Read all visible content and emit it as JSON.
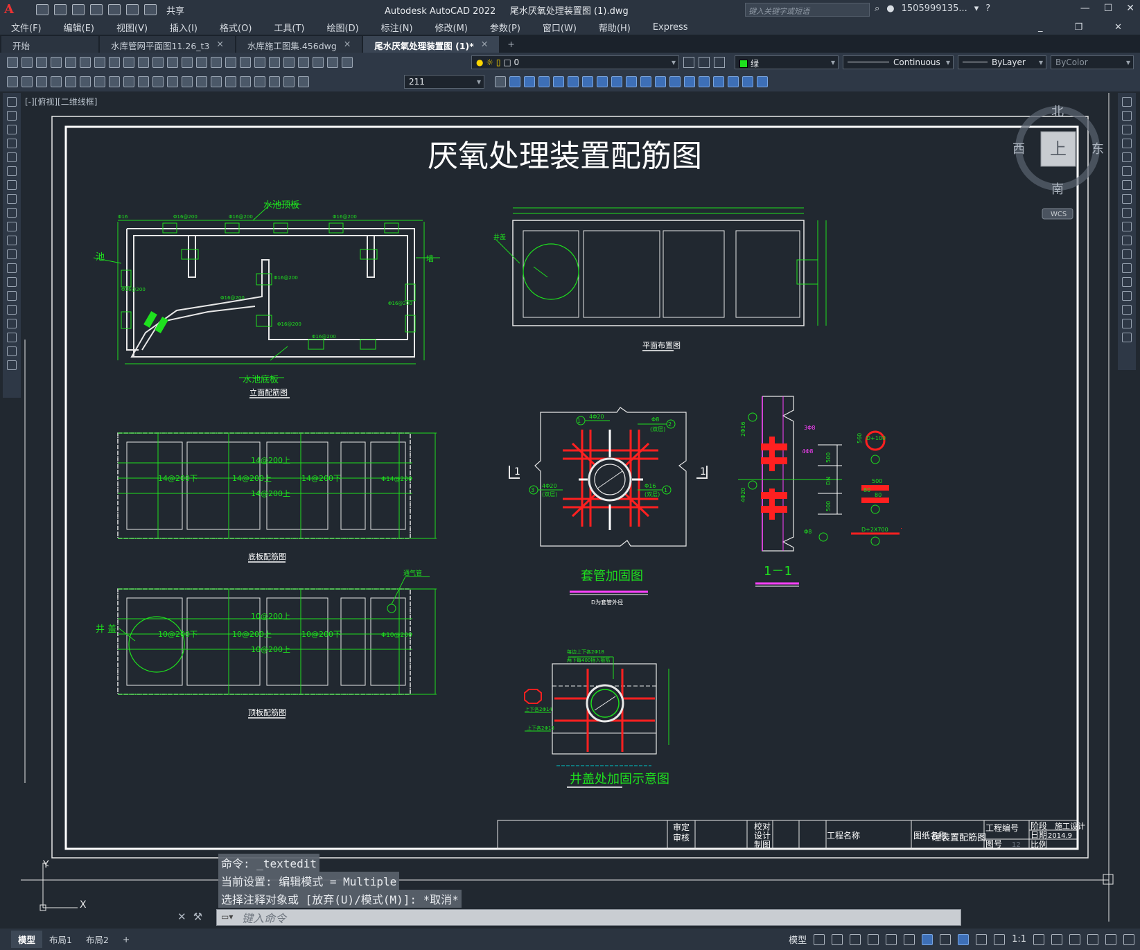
{
  "titlebar": {
    "share_label": "共享",
    "app_name": "Autodesk AutoCAD 2022",
    "file_name": "尾水厌氧处理装置图 (1).dwg",
    "search_placeholder": "键入关键字或短语",
    "user": "1505999135...",
    "help": "?"
  },
  "menu": [
    "文件(F)",
    "编辑(E)",
    "视图(V)",
    "插入(I)",
    "格式(O)",
    "工具(T)",
    "绘图(D)",
    "标注(N)",
    "修改(M)",
    "参数(P)",
    "窗口(W)",
    "帮助(H)",
    "Express"
  ],
  "tabs": [
    {
      "label": "开始",
      "closable": false,
      "active": false
    },
    {
      "label": "水库管网平面图11.26_t3",
      "closable": true,
      "active": false
    },
    {
      "label": "水库施工图集.456dwg",
      "closable": true,
      "active": false
    },
    {
      "label": "尾水厌氧处理装置图 (1)*",
      "closable": true,
      "active": true
    }
  ],
  "tab_close": "✕",
  "tab_add": "+",
  "layer_dropdown": "0",
  "color_dropdown": "绿",
  "linetype_dropdown": "Continuous",
  "lineweight_dropdown": "ByLayer",
  "plotstyle_dropdown": "ByColor",
  "dimstyle_dropdown": "211",
  "view_label": "[-][俯视][二维线框]",
  "viewcube": {
    "north": "北",
    "south": "南",
    "east": "东",
    "west": "西",
    "top": "上",
    "wcs": "WCS"
  },
  "drawing": {
    "main_title": "厌氧处理装置配筋图",
    "elev_title": "立面配筋图",
    "elev_top_label": "水池顶板",
    "elev_bottom_label": "水池底板",
    "elev_left_label": "池",
    "elev_right_label": "墙",
    "plan_title": "平面布置图",
    "plan_left_label": "井盖",
    "bottom_slab_title": "底板配筋图",
    "bottom_slab_rebar": [
      "14@200上",
      "14@200下",
      "14@200上",
      "14@200下",
      "14@200上",
      "Φ14@200"
    ],
    "top_slab_title": "顶板配筋图",
    "top_slab_rebar": [
      "10@200上",
      "10@200下",
      "10@200上",
      "10@200下",
      "10@200上",
      "Φ10@200"
    ],
    "top_slab_left_label": "井 盖",
    "top_slab_right_label": "通气管",
    "sleeve_title": "套管加固图",
    "sleeve_sub": "D为套管外径",
    "sleeve_labels": [
      "4Φ20",
      "Φ8",
      "4Φ20",
      "Φ16",
      "(双层)",
      "(双层)",
      "(双层)",
      "(双层)"
    ],
    "sleeve_circles": [
      "1",
      "2",
      "3",
      "1"
    ],
    "section_title": "1－1",
    "section_labels": [
      "2Φ16",
      "4Φ20",
      "500",
      "500",
      "DN",
      "Φ8",
      "D+2X700",
      "500",
      "80",
      "80",
      "D+100",
      "560"
    ],
    "well_title": "井盖处加固示意图",
    "well_labels": [
      "每边上下各2Φ18",
      "两下每400插入箍筋",
      "上下各2Φ14",
      "上下各2Φ18"
    ],
    "tb_approve": "审定",
    "tb_audit": "审核",
    "tb_check": "校对",
    "tb_design": "设计",
    "tb_draw": "制图",
    "tb_project": "工程名称",
    "tb_sheet_name": "图纸名称",
    "tb_sheet_value": "理装置配筋图",
    "tb_project_no": "工程编号",
    "tb_sheet_no": "图号",
    "tb_sheet_no_value": "12",
    "tb_stage": "阶段",
    "tb_stage_value": "施工设计",
    "tb_date": "日期",
    "tb_date_value": "2014.9",
    "tb_scale": "比例"
  },
  "ucs": {
    "x": "X",
    "y": "Y"
  },
  "command_history": [
    "命令:  _textedit",
    "当前设置: 编辑模式 = Multiple",
    "选择注释对象或 [放弃(U)/模式(M)]: *取消*"
  ],
  "command_placeholder": "键入命令",
  "layouts": [
    "模型",
    "布局1",
    "布局2"
  ],
  "layout_add": "+",
  "status": {
    "model": "模型",
    "scale": "1:1"
  }
}
